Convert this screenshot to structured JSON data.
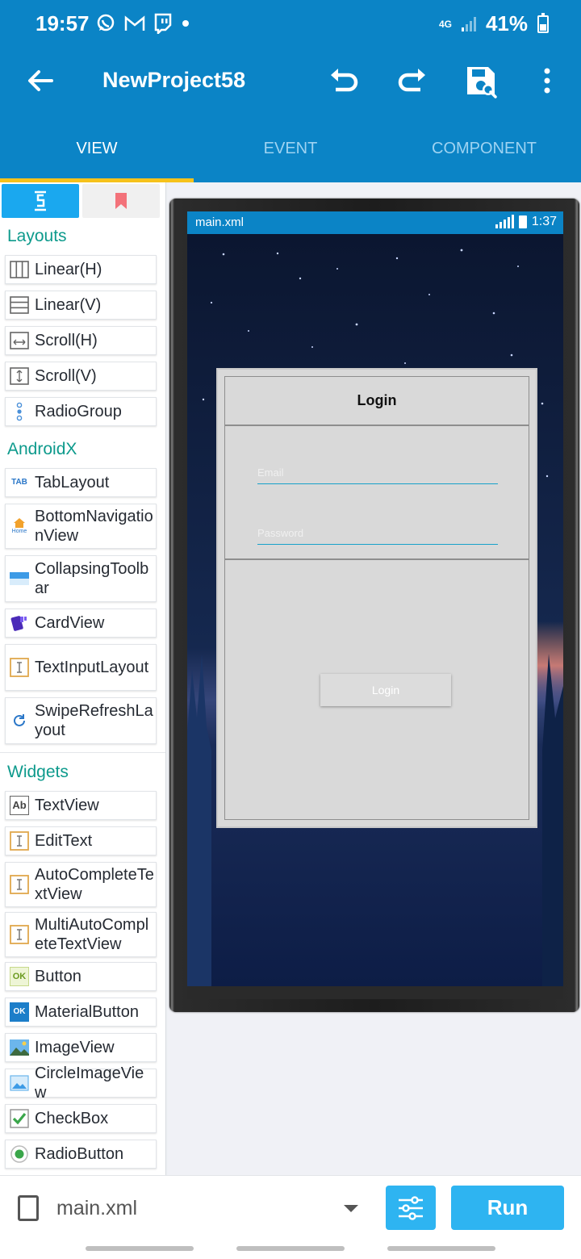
{
  "status_bar": {
    "time": "19:57",
    "network_type": "4G",
    "battery_percent": "41%",
    "battery_level": 0.41,
    "signal_level": 1,
    "left_icons": [
      "whatsapp-icon",
      "gmail-icon",
      "twitch-icon",
      "dot-icon"
    ]
  },
  "app_bar": {
    "title": "NewProject58",
    "actions": [
      "undo-icon",
      "redo-icon",
      "save-icon",
      "more-icon"
    ]
  },
  "tabs": [
    {
      "label": "VIEW",
      "active": true
    },
    {
      "label": "EVENT",
      "active": false
    },
    {
      "label": "COMPONENT",
      "active": false
    }
  ],
  "palette": {
    "tab_icons": [
      "widget-icon",
      "bookmark-icon"
    ],
    "sections": [
      {
        "title": "Layouts",
        "items": [
          {
            "label": "Linear(H)",
            "icon": "linear-h-icon"
          },
          {
            "label": "Linear(V)",
            "icon": "linear-v-icon"
          },
          {
            "label": "Scroll(H)",
            "icon": "scroll-h-icon"
          },
          {
            "label": "Scroll(V)",
            "icon": "scroll-v-icon"
          },
          {
            "label": "RadioGroup",
            "icon": "radiogroup-icon"
          }
        ]
      },
      {
        "title": "AndroidX",
        "items": [
          {
            "label": "TabLayout",
            "icon": "tab-icon",
            "icon_text": "TAB"
          },
          {
            "label": "BottomNavigationView",
            "icon": "home-icon",
            "icon_text": "Home"
          },
          {
            "label": "CollapsingToolbar",
            "icon": "toolbar-icon"
          },
          {
            "label": "CardView",
            "icon": "card-icon"
          },
          {
            "label": "TextInputLayout",
            "icon": "text-input-icon"
          },
          {
            "label": "SwipeRefreshLayout",
            "icon": "refresh-icon"
          }
        ]
      },
      {
        "title": "Widgets",
        "items": [
          {
            "label": "TextView",
            "icon": "textview-icon",
            "icon_text": "Ab"
          },
          {
            "label": "EditText",
            "icon": "edittext-icon"
          },
          {
            "label": "AutoCompleteTextView",
            "icon": "edittext-icon"
          },
          {
            "label": "MultiAutoCompleteTextView",
            "icon": "edittext-icon"
          },
          {
            "label": "Button",
            "icon": "button-icon",
            "icon_text": "OK"
          },
          {
            "label": "MaterialButton",
            "icon": "material-button-icon",
            "icon_text": "OK"
          },
          {
            "label": "ImageView",
            "icon": "image-icon"
          },
          {
            "label": "CircleImageView",
            "icon": "circle-image-icon"
          },
          {
            "label": "CheckBox",
            "icon": "checkbox-icon"
          },
          {
            "label": "RadioButton",
            "icon": "radiobutton-icon"
          }
        ]
      }
    ]
  },
  "preview": {
    "status_title": "main.xml",
    "status_time": "1:37",
    "login_card": {
      "header": "Login",
      "email_hint": "Email",
      "password_hint": "Password",
      "button": "Login"
    }
  },
  "bottom_bar": {
    "file_name": "main.xml",
    "run_label": "Run"
  },
  "colors": {
    "primary": "#0b84c6",
    "tab_indicator": "#f6c21b",
    "section_title": "#0d9a8c",
    "button_accent": "#2eb4f1"
  }
}
